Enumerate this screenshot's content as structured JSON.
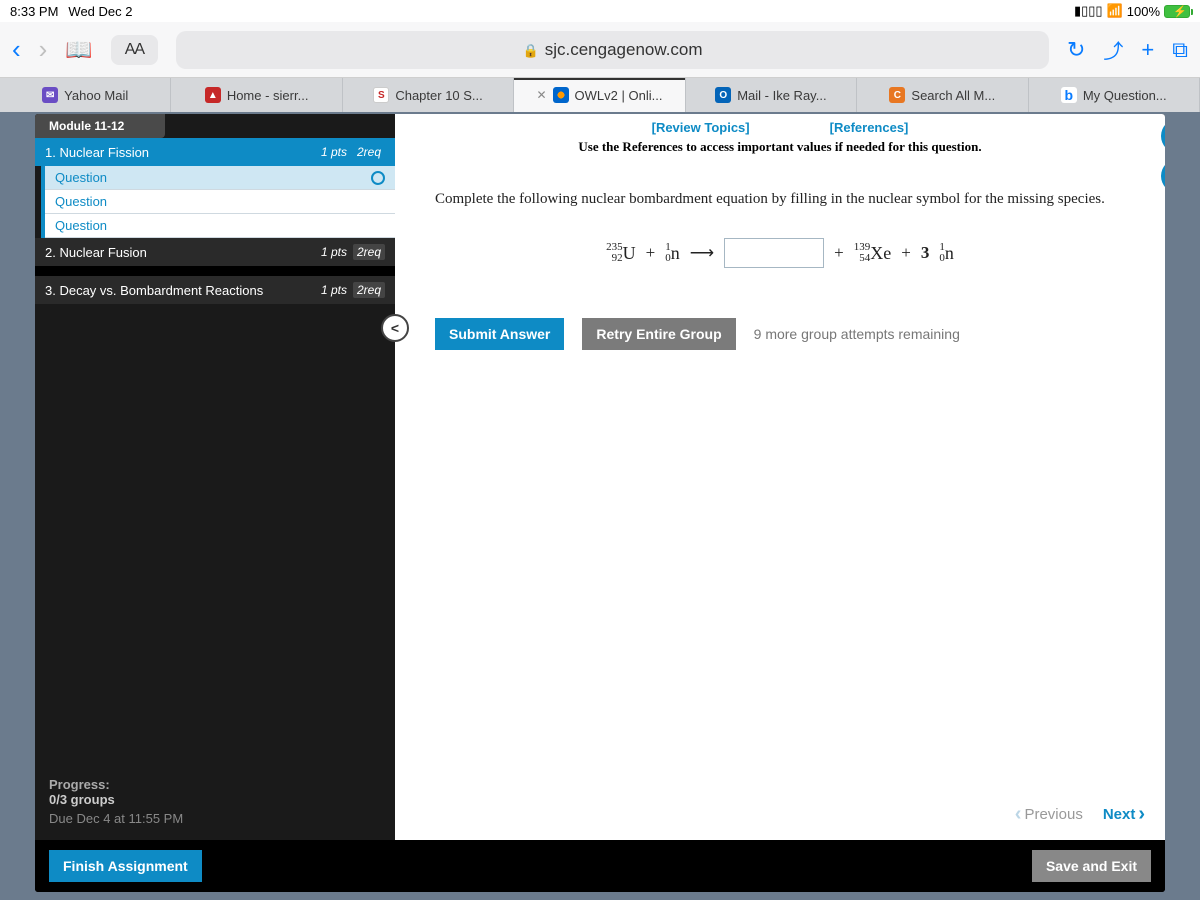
{
  "status": {
    "time": "8:33 PM",
    "date": "Wed Dec 2",
    "battery": "100%"
  },
  "safari": {
    "textsize": "AA",
    "url": "sjc.cengagenow.com"
  },
  "tabs": [
    {
      "label": "Yahoo Mail"
    },
    {
      "label": "Home - sierr..."
    },
    {
      "label": "Chapter 10 S..."
    },
    {
      "label": "OWLv2 | Onli...",
      "active": true
    },
    {
      "label": "Mail - Ike Ray..."
    },
    {
      "label": "Search All M..."
    },
    {
      "label": "My Question..."
    }
  ],
  "sidebar": {
    "module": "Module 11-12",
    "sections": [
      {
        "title": "1. Nuclear Fission",
        "pts": "1 pts",
        "req": "2req"
      },
      {
        "title": "2. Nuclear Fusion",
        "pts": "1 pts",
        "req": "2req"
      },
      {
        "title": "3. Decay vs. Bombardment Reactions",
        "pts": "1 pts",
        "req": "2req"
      }
    ],
    "questions": [
      "Question",
      "Question",
      "Question"
    ]
  },
  "main": {
    "links": {
      "review": "[Review Topics]",
      "refs": "[References]"
    },
    "refnote": "Use the References to access important values if needed for this question.",
    "prompt": "Complete the following nuclear bombardment equation by filling in the nuclear symbol for the missing species.",
    "equation": {
      "u_mass": "235",
      "u_z": "92",
      "u_sym": "U",
      "n1_mass": "1",
      "n1_z": "0",
      "n1_sym": "n",
      "xe_mass": "139",
      "xe_z": "54",
      "xe_sym": "Xe",
      "n2_coeff": "3",
      "n2_mass": "1",
      "n2_z": "0",
      "n2_sym": "n"
    },
    "submit": "Submit Answer",
    "retry": "Retry Entire Group",
    "attempts": "9 more group attempts remaining",
    "prev": "Previous",
    "next": "Next"
  },
  "progress": {
    "title": "Progress:",
    "groups": "0/3 groups",
    "due": "Due Dec 4 at 11:55 PM"
  },
  "footer": {
    "finish": "Finish Assignment",
    "save": "Save and Exit"
  },
  "support": {
    "help": "?"
  }
}
